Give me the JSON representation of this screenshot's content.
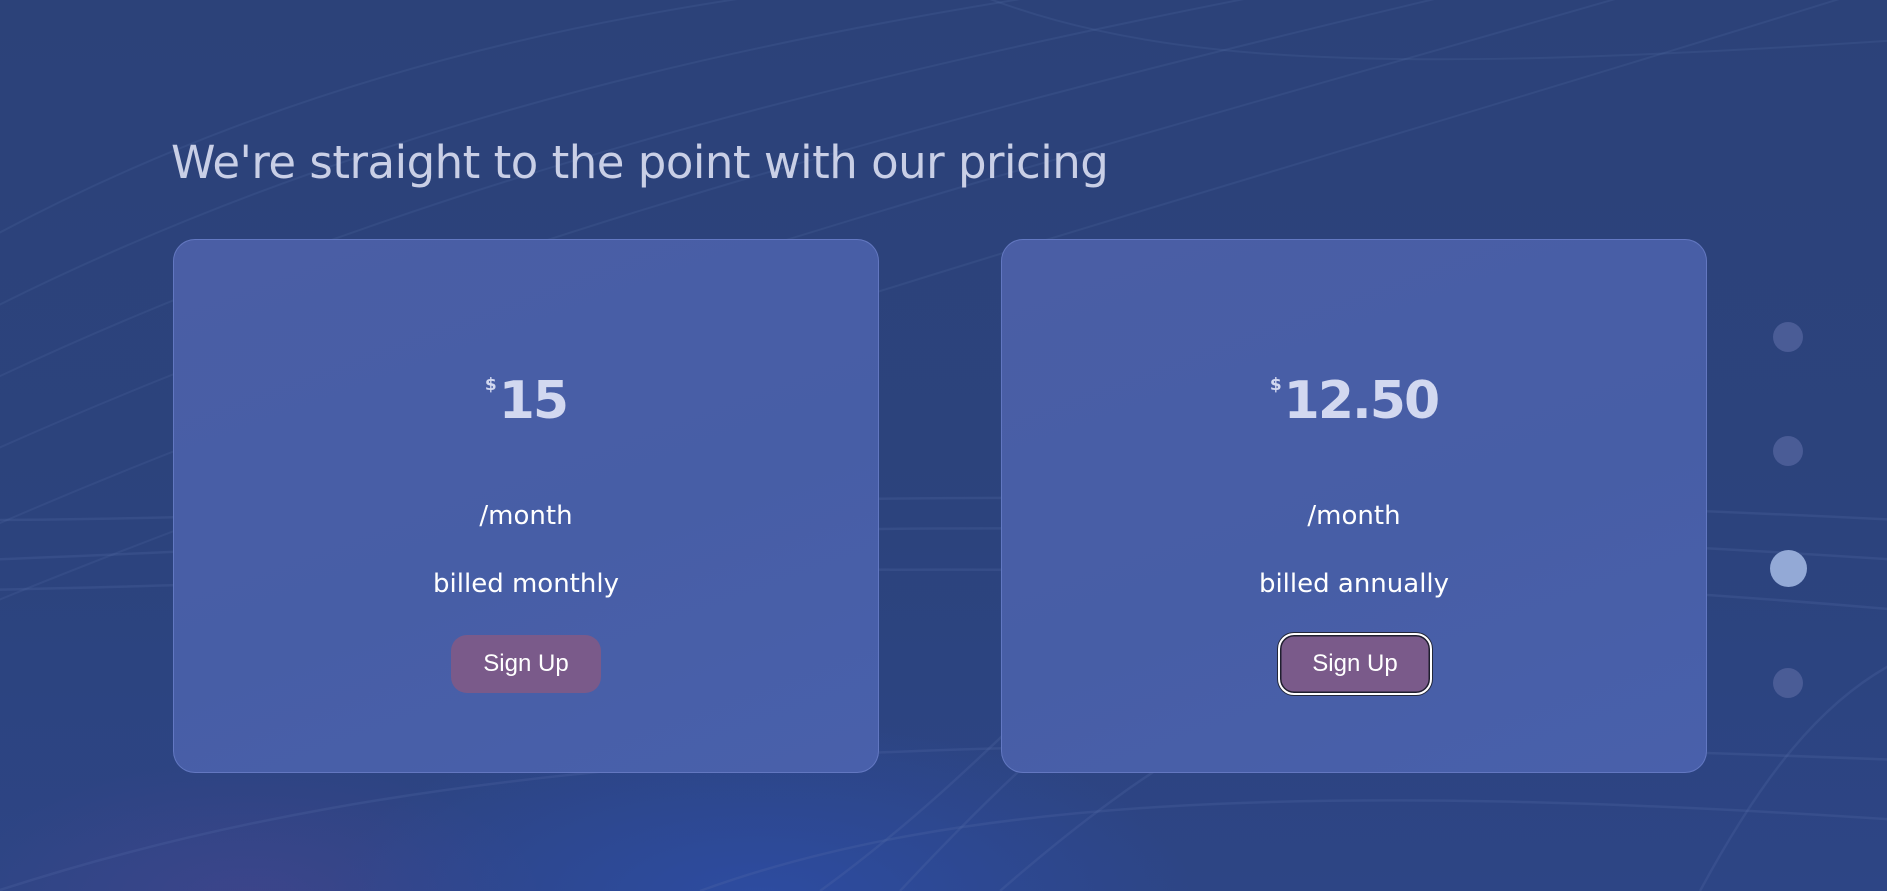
{
  "headline": "We're straight to the point with our pricing",
  "plans": [
    {
      "currency": "$",
      "amount": "15",
      "period": "/month",
      "billing": "billed monthly",
      "button_label": "Sign Up"
    },
    {
      "currency": "$",
      "amount": "12.50",
      "period": "/month",
      "billing": "billed annually",
      "button_label": "Sign Up"
    }
  ],
  "pagination": {
    "count": 4,
    "active_index": 2
  },
  "colors": {
    "background": "#2c437c",
    "card": "#4a5ea5",
    "button": "#7a5a8a",
    "heading_text": "#c9cfe6",
    "active_dot": "#93a9d6",
    "inactive_dot": "#4a5c96"
  }
}
